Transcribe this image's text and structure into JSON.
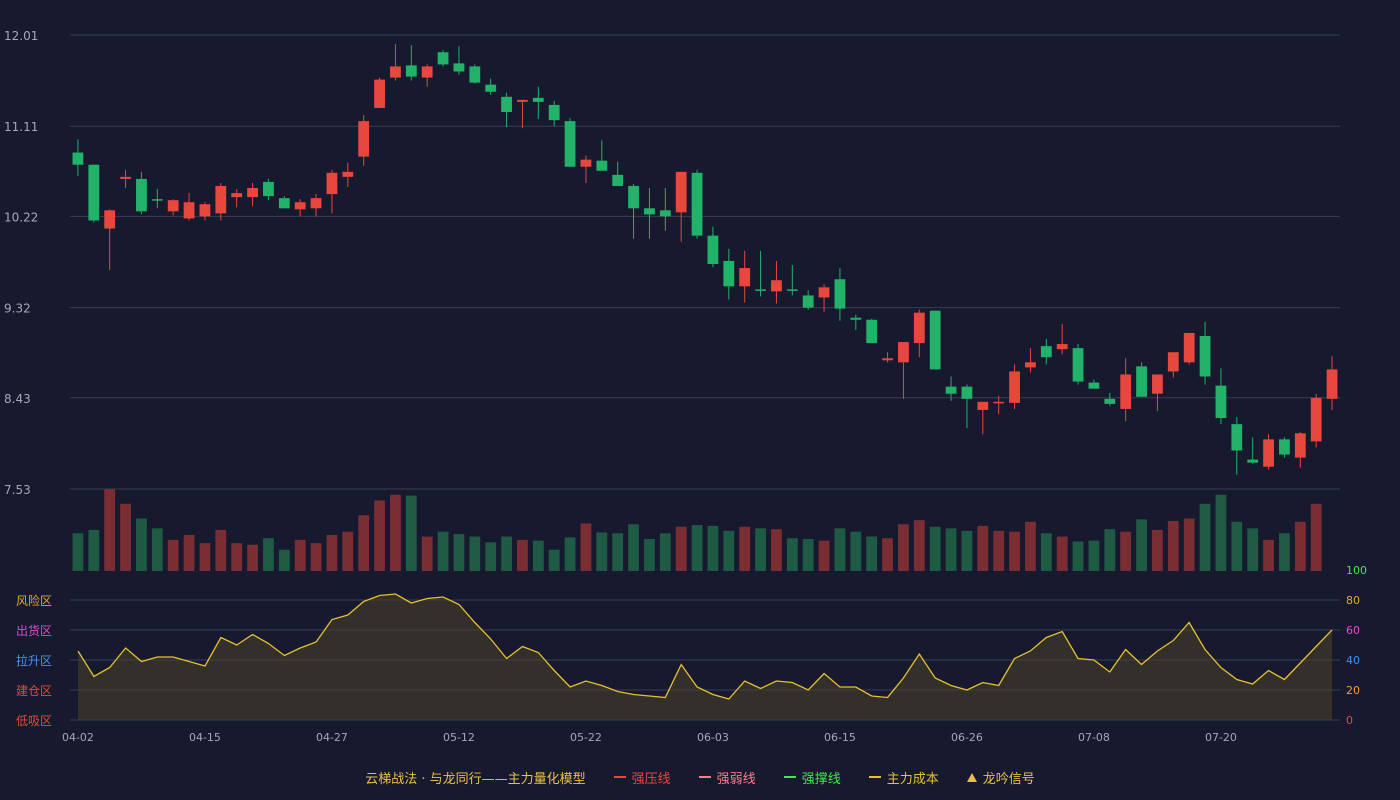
{
  "colors": {
    "background": "#171a2e",
    "up": "#e8473d",
    "down": "#22b26a",
    "volume_up": "#7a2e33",
    "volume_down": "#1f5a44",
    "line": "#e6c12e",
    "grid": "#3a3d52",
    "axis_text": "#a4a7b8",
    "zone_risk": "#e8a33a",
    "zone_distribute": "#e24ad6",
    "zone_rise": "#4d8ff0",
    "zone_build": "#e8473d",
    "zone_absorb": "#e8473d",
    "tick_100": "#41e84d",
    "tick_80": "#e8a33a",
    "tick_60": "#e24ad6",
    "tick_40": "#4d8ff0",
    "tick_20": "#e8a33a",
    "tick_0": "#e8473d"
  },
  "chart_data": [
    {
      "type": "candlestick",
      "y_ticks": [
        "12.01",
        "11.11",
        "10.22",
        "9.32",
        "8.43",
        "7.53"
      ],
      "ylim": [
        7.53,
        12.01
      ],
      "x_tick_labels": [
        "04-02",
        "04-15",
        "04-27",
        "05-12",
        "05-22",
        "06-03",
        "06-15",
        "06-26",
        "07-08",
        "07-20"
      ],
      "x_tick_index": [
        0,
        8,
        16,
        24,
        32,
        40,
        48,
        56,
        64,
        72
      ],
      "grid": true,
      "ohlc": [
        [
          10.85,
          10.98,
          10.62,
          10.73
        ],
        [
          10.73,
          10.73,
          10.16,
          10.18
        ],
        [
          10.1,
          10.29,
          9.69,
          10.28
        ],
        [
          10.59,
          10.68,
          10.5,
          10.61
        ],
        [
          10.59,
          10.66,
          10.24,
          10.27
        ],
        [
          10.39,
          10.49,
          10.3,
          10.38
        ],
        [
          10.27,
          10.39,
          10.23,
          10.38
        ],
        [
          10.2,
          10.45,
          10.18,
          10.36
        ],
        [
          10.22,
          10.36,
          10.18,
          10.34
        ],
        [
          10.25,
          10.55,
          10.18,
          10.52
        ],
        [
          10.41,
          10.49,
          10.31,
          10.45
        ],
        [
          10.41,
          10.55,
          10.32,
          10.5
        ],
        [
          10.56,
          10.59,
          10.38,
          10.42
        ],
        [
          10.4,
          10.42,
          10.3,
          10.3
        ],
        [
          10.29,
          10.39,
          10.22,
          10.36
        ],
        [
          10.3,
          10.44,
          10.22,
          10.4
        ],
        [
          10.44,
          10.68,
          10.25,
          10.65
        ],
        [
          10.61,
          10.75,
          10.51,
          10.66
        ],
        [
          10.81,
          11.22,
          10.72,
          11.16
        ],
        [
          11.29,
          11.59,
          11.29,
          11.57
        ],
        [
          11.59,
          11.92,
          11.56,
          11.7
        ],
        [
          11.71,
          11.91,
          11.56,
          11.6
        ],
        [
          11.59,
          11.72,
          11.5,
          11.7
        ],
        [
          11.84,
          11.86,
          11.7,
          11.72
        ],
        [
          11.73,
          11.9,
          11.62,
          11.65
        ],
        [
          11.7,
          11.72,
          11.53,
          11.54
        ],
        [
          11.52,
          11.58,
          11.42,
          11.45
        ],
        [
          11.4,
          11.44,
          11.1,
          11.25
        ],
        [
          11.35,
          11.36,
          11.09,
          11.37
        ],
        [
          11.39,
          11.5,
          11.18,
          11.35
        ],
        [
          11.32,
          11.36,
          11.11,
          11.17
        ],
        [
          11.16,
          11.19,
          10.71,
          10.71
        ],
        [
          10.71,
          10.82,
          10.55,
          10.78
        ],
        [
          10.77,
          10.97,
          10.69,
          10.67
        ],
        [
          10.63,
          10.76,
          10.56,
          10.52
        ],
        [
          10.52,
          10.54,
          10.0,
          10.3
        ],
        [
          10.3,
          10.5,
          10.0,
          10.24
        ],
        [
          10.28,
          10.5,
          10.08,
          10.22
        ],
        [
          10.26,
          10.55,
          9.97,
          10.66
        ],
        [
          10.65,
          10.68,
          10.0,
          10.03
        ],
        [
          10.03,
          10.12,
          9.72,
          9.75
        ],
        [
          9.78,
          9.9,
          9.4,
          9.53
        ],
        [
          9.53,
          9.88,
          9.37,
          9.71
        ],
        [
          9.5,
          9.88,
          9.43,
          9.49
        ],
        [
          9.48,
          9.78,
          9.36,
          9.59
        ],
        [
          9.5,
          9.74,
          9.44,
          9.49
        ],
        [
          9.44,
          9.49,
          9.3,
          9.32
        ],
        [
          9.42,
          9.55,
          9.28,
          9.52
        ],
        [
          9.6,
          9.71,
          9.19,
          9.31
        ],
        [
          9.22,
          9.25,
          9.1,
          9.2
        ],
        [
          9.2,
          9.21,
          9.0,
          8.97
        ],
        [
          8.8,
          8.88,
          8.78,
          8.82
        ],
        [
          8.78,
          8.97,
          8.42,
          8.98
        ],
        [
          8.97,
          9.3,
          8.83,
          9.27
        ],
        [
          9.29,
          9.29,
          8.73,
          8.71
        ],
        [
          8.54,
          8.64,
          8.4,
          8.47
        ],
        [
          8.54,
          8.56,
          8.13,
          8.42
        ],
        [
          8.31,
          8.39,
          8.07,
          8.39
        ],
        [
          8.39,
          8.45,
          8.27,
          8.39
        ],
        [
          8.38,
          8.76,
          8.32,
          8.69
        ],
        [
          8.73,
          8.92,
          8.68,
          8.78
        ],
        [
          8.94,
          9.01,
          8.76,
          8.83
        ],
        [
          8.91,
          9.16,
          8.86,
          8.96
        ],
        [
          8.92,
          8.96,
          8.56,
          8.59
        ],
        [
          8.58,
          8.61,
          8.52,
          8.52
        ],
        [
          8.42,
          8.48,
          8.35,
          8.37
        ],
        [
          8.32,
          8.82,
          8.2,
          8.66
        ],
        [
          8.74,
          8.78,
          8.46,
          8.44
        ],
        [
          8.47,
          8.61,
          8.3,
          8.66
        ],
        [
          8.69,
          8.84,
          8.63,
          8.88
        ],
        [
          8.78,
          9.06,
          8.76,
          9.07
        ],
        [
          9.04,
          9.18,
          8.56,
          8.64
        ],
        [
          8.55,
          8.72,
          8.17,
          8.23
        ],
        [
          8.17,
          8.24,
          7.67,
          7.91
        ],
        [
          7.82,
          8.04,
          7.78,
          7.79
        ],
        [
          7.75,
          8.07,
          7.72,
          8.02
        ],
        [
          8.02,
          8.04,
          7.84,
          7.87
        ],
        [
          7.84,
          8.09,
          7.74,
          8.08
        ],
        [
          8.0,
          8.47,
          7.94,
          8.43
        ],
        [
          8.42,
          8.84,
          8.31,
          8.71
        ]
      ],
      "volume": [
        46,
        50,
        100,
        82,
        64,
        52,
        38,
        44,
        34,
        50,
        34,
        32,
        40,
        26,
        38,
        34,
        44,
        48,
        68,
        86,
        93,
        92,
        42,
        48,
        45,
        42,
        35,
        42,
        38,
        37,
        26,
        41,
        58,
        47,
        46,
        57,
        39,
        46,
        54,
        56,
        55,
        49,
        54,
        52,
        51,
        40,
        39,
        37,
        52,
        48,
        42,
        40,
        57,
        62,
        54,
        52,
        49,
        55,
        49,
        48,
        60,
        46,
        42,
        36,
        37,
        51,
        48,
        63,
        50,
        61,
        64,
        82,
        93,
        60,
        52,
        38,
        46,
        60,
        82
      ]
    },
    {
      "type": "area",
      "ylim": [
        0,
        100
      ],
      "y_ticks": [
        100,
        80,
        60,
        40,
        20,
        0
      ],
      "zone_labels": [
        "风险区",
        "出货区",
        "拉升区",
        "建仓区",
        "低吸区"
      ],
      "values": [
        46,
        29,
        35,
        48,
        39,
        42,
        42,
        39,
        36,
        55,
        50,
        57,
        51,
        43,
        48,
        52,
        67,
        70,
        79,
        83,
        84,
        78,
        81,
        82,
        77,
        65,
        54,
        41,
        49,
        45,
        33,
        22,
        26,
        23,
        19,
        17,
        16,
        15,
        37,
        22,
        17,
        14,
        26,
        21,
        26,
        25,
        20,
        31,
        22,
        22,
        16,
        15,
        28,
        44,
        28,
        23,
        20,
        25,
        23,
        41,
        46,
        55,
        59,
        41,
        40,
        32,
        47,
        37,
        46,
        53,
        65,
        47,
        35,
        27,
        24,
        33,
        27,
        38,
        49,
        60
      ]
    }
  ],
  "legend": {
    "title": "云梯战法 · 与龙同行——主力量化模型",
    "items": [
      {
        "label": "强压线",
        "color": "#e8473d",
        "style": "solid"
      },
      {
        "label": "强弱线",
        "color": "#ff7d8c",
        "style": "dashed"
      },
      {
        "label": "强撑线",
        "color": "#41e84d",
        "style": "solid"
      },
      {
        "label": "主力成本",
        "color": "#e6c12e",
        "style": "dashed"
      },
      {
        "label": "龙吟信号",
        "color": "#e8c046",
        "style": "triangle"
      }
    ]
  }
}
